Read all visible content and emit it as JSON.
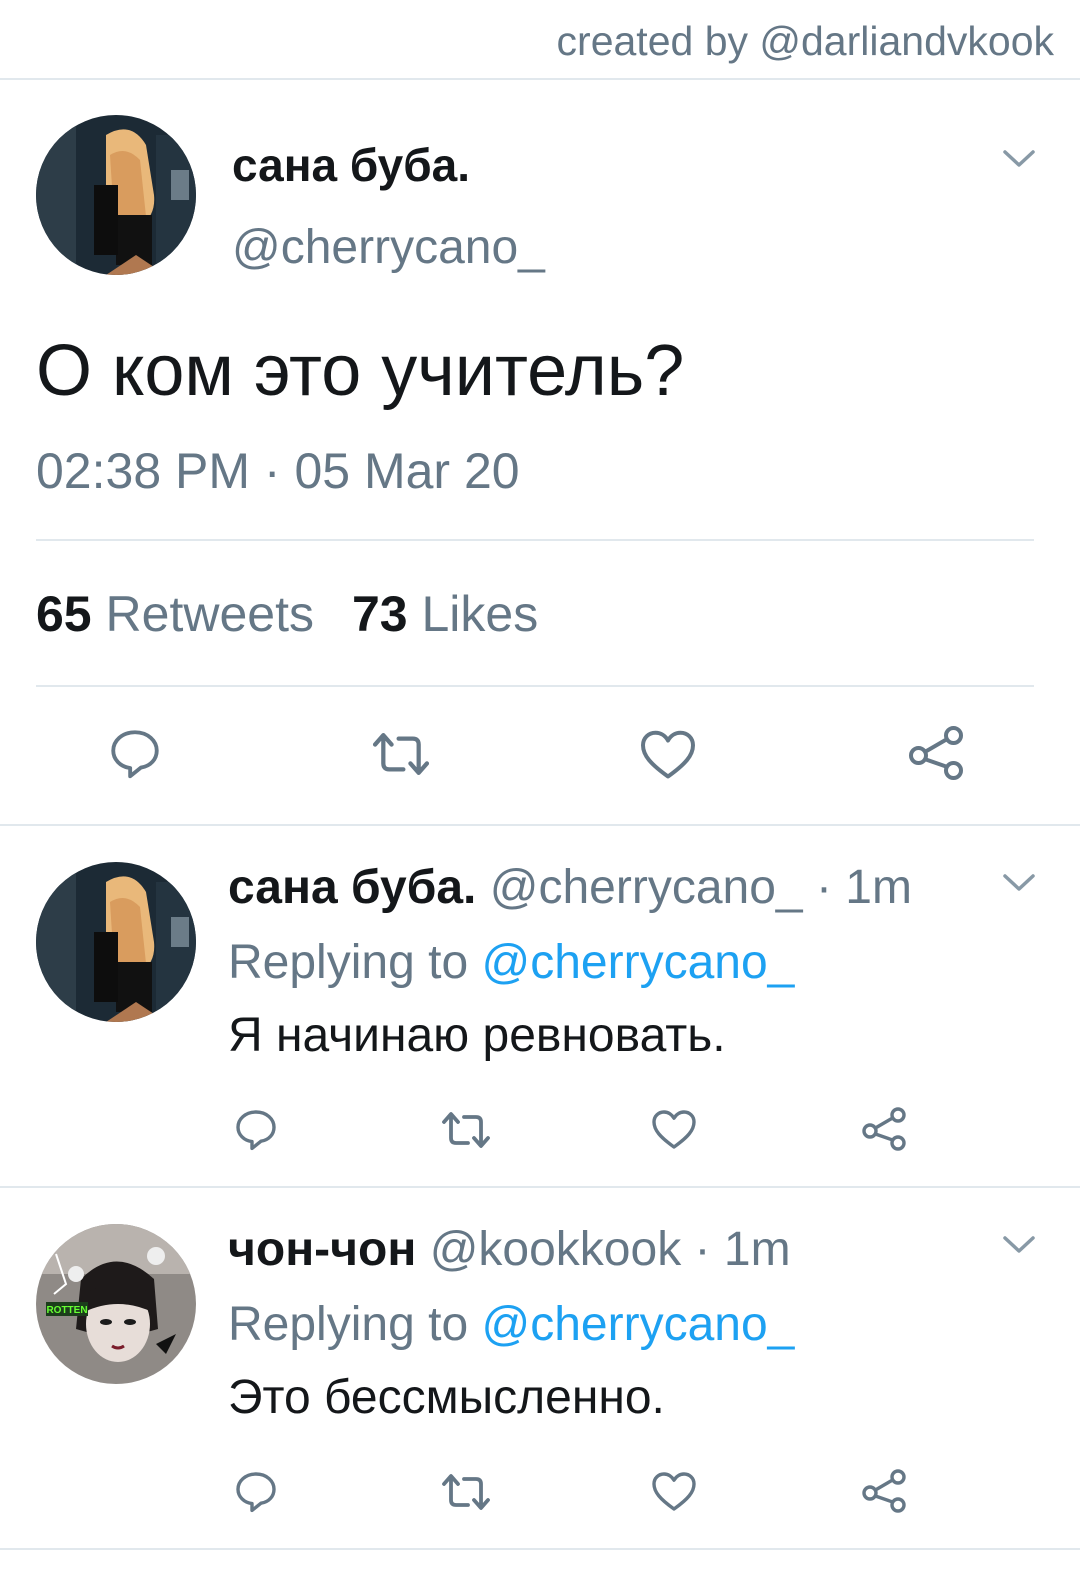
{
  "credit": "created by @darliandvkook",
  "main_tweet": {
    "author_name": "сана буба.",
    "handle": "@cherrycano_",
    "text": "О ком это учитель?",
    "timestamp": "02:38 PM · 05 Mar 20",
    "retweets_count": "65",
    "retweets_label": "Retweets",
    "likes_count": "73",
    "likes_label": "Likes",
    "actions": [
      "reply-icon",
      "retweet-icon",
      "like-icon",
      "share-icon"
    ]
  },
  "replies": [
    {
      "author_name": "сана буба.",
      "handle": "@cherrycano_",
      "time": "· 1m",
      "replying_label": "Replying to",
      "replying_to": "@cherrycano_",
      "text": "Я начинаю ревновать."
    },
    {
      "author_name": "чон-чон",
      "handle": "@kookkook",
      "time": "· 1m",
      "replying_label": "Replying to",
      "replying_to": "@cherrycano_",
      "text": "Это бессмысленно.",
      "avatar_sticker_text": "ROTTEN"
    }
  ],
  "colors": {
    "text": "#14171a",
    "secondary": "#657786",
    "link": "#1da1f2",
    "divider": "#e1e8ed"
  }
}
